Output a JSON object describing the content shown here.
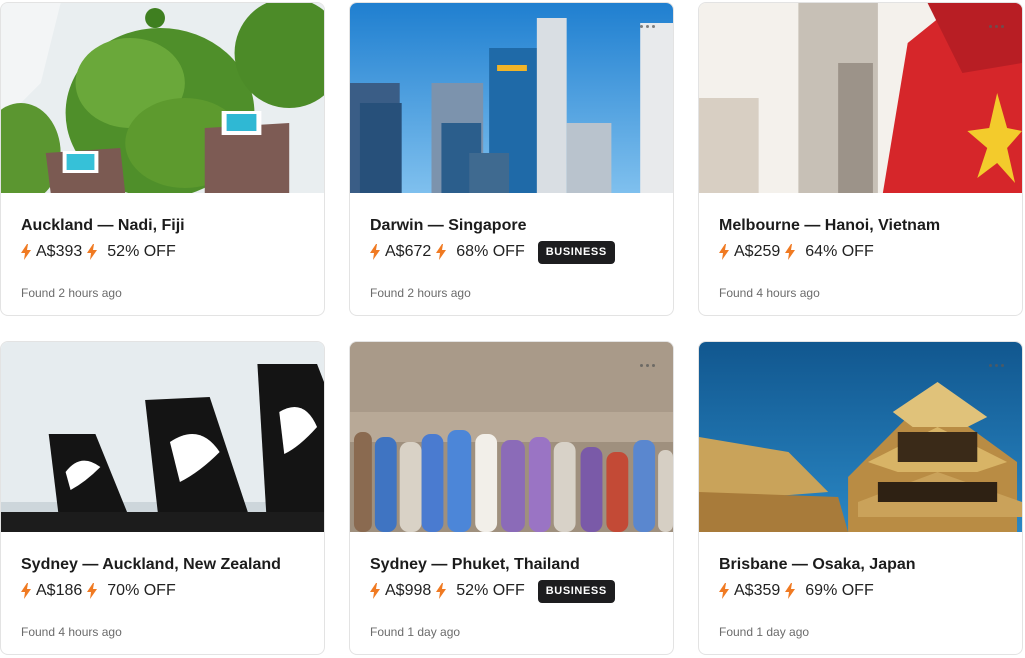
{
  "colors": {
    "bolt": "#f07a22",
    "badge_bg": "#1d1d1f",
    "muted": "#6b6b6b"
  },
  "cards": [
    {
      "route": "Auckland — Nadi, Fiji",
      "price": "A$393",
      "discount": "52% OFF",
      "badge": "",
      "found": "Found 2 hours ago",
      "image": "fiji-villas-image"
    },
    {
      "route": "Darwin — Singapore",
      "price": "A$672",
      "discount": "68% OFF",
      "badge": "BUSINESS",
      "found": "Found 2 hours ago",
      "image": "singapore-skyline-image"
    },
    {
      "route": "Melbourne — Hanoi, Vietnam",
      "price": "A$259",
      "discount": "64% OFF",
      "badge": "",
      "found": "Found 4 hours ago",
      "image": "vietnam-flag-image"
    },
    {
      "route": "Sydney — Auckland, New Zealand",
      "price": "A$186",
      "discount": "70% OFF",
      "badge": "",
      "found": "Found 4 hours ago",
      "image": "air-nz-tails-image"
    },
    {
      "route": "Sydney — Phuket, Thailand",
      "price": "A$998",
      "discount": "52% OFF",
      "badge": "BUSINESS",
      "found": "Found 1 day ago",
      "image": "longtail-boats-image"
    },
    {
      "route": "Brisbane — Osaka, Japan",
      "price": "A$359",
      "discount": "69% OFF",
      "badge": "",
      "found": "Found 1 day ago",
      "image": "osaka-castle-image"
    }
  ]
}
